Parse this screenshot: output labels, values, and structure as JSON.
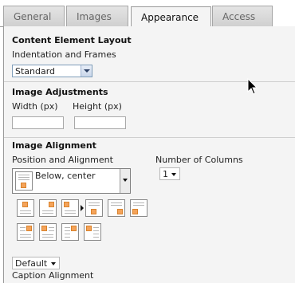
{
  "tabs": [
    {
      "label": "General",
      "active": false
    },
    {
      "label": "Images",
      "active": false
    },
    {
      "label": "Appearance",
      "active": true
    },
    {
      "label": "Access",
      "active": false
    }
  ],
  "layout": {
    "heading": "Content Element Layout",
    "indent_label": "Indentation and Frames",
    "indent_value": "Standard"
  },
  "adjust": {
    "heading": "Image Adjustments",
    "width_label": "Width (px)",
    "height_label": "Height (px)",
    "width_value": "",
    "height_value": ""
  },
  "align": {
    "heading": "Image Alignment",
    "position_label": "Position and Alignment",
    "position_value": "Below, center",
    "columns_label": "Number of Columns",
    "columns_value": "1",
    "caption_label": "Caption Alignment",
    "caption_value": "Default"
  },
  "icons": {
    "cursor": "mouse-pointer-icon",
    "accent": "#f4a35a"
  }
}
